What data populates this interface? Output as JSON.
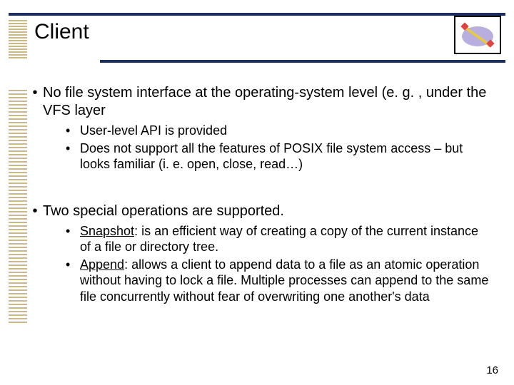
{
  "title": "Client",
  "bullets": {
    "b1_text": "No file system interface at the operating-system level (e. g. , under the VFS layer",
    "b1_sub1": "User-level API is provided",
    "b1_sub2": "Does not support all the features of POSIX file system access – but looks familiar (i. e. open, close, read…)",
    "b2_text": "Two special operations are supported.",
    "b2_sub1_term": "Snapshot",
    "b2_sub1_rest": ": is an efficient way of creating a copy of the current instance of a file or directory tree.",
    "b2_sub2_term": "Append",
    "b2_sub2_rest": ": allows a client to append data to a file as an atomic operation without having to lock a file. Multiple processes can append to the same file concurrently without fear of overwriting one another's data"
  },
  "page_number": "16"
}
